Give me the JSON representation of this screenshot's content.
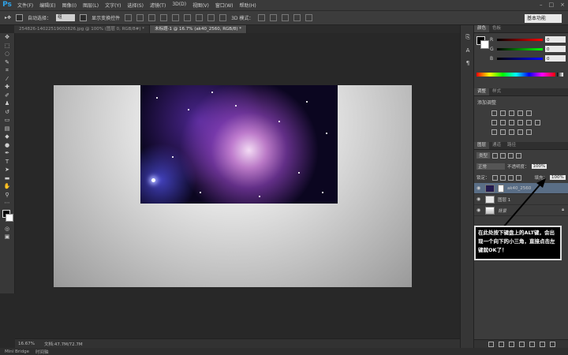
{
  "app": {
    "logo": "Ps"
  },
  "menu": [
    "文件(F)",
    "编辑(E)",
    "图像(I)",
    "图层(L)",
    "文字(Y)",
    "选择(S)",
    "滤镜(T)",
    "3D(D)",
    "视图(V)",
    "窗口(W)",
    "帮助(H)"
  ],
  "window_buttons": [
    "–",
    "□",
    "×"
  ],
  "options_bar": {
    "auto_select_label": "自动选择：",
    "auto_select_value": "组",
    "show_transform_label": "显示变换控件",
    "mode_3d_label": "3D 模式：",
    "workspace": "基本功能"
  },
  "tabs": [
    {
      "label": "254826-14022519002826.jpg @ 100% (图层 0, RGB/8#) *",
      "active": false
    },
    {
      "label": "未标题-1 @ 16.7% (ak40_2560, RGB/8) *",
      "active": true
    }
  ],
  "status": {
    "zoom": "16.67%",
    "doc": "文档:47.7M/72.7M"
  },
  "bottom": {
    "mini_bridge": "Mini Bridge",
    "timeline": "时间轴"
  },
  "color_panel": {
    "tabs": [
      "颜色",
      "色板"
    ],
    "rows": [
      {
        "label": "R",
        "value": "0"
      },
      {
        "label": "G",
        "value": "0"
      },
      {
        "label": "B",
        "value": "0"
      }
    ]
  },
  "adjust_panel": {
    "tabs": [
      "调整",
      "样式"
    ],
    "title": "添加调整"
  },
  "layers_panel": {
    "tabs": [
      "图层",
      "通道",
      "路径"
    ],
    "filter": "类型",
    "blend_mode": "正常",
    "opacity_label": "不透明度：",
    "opacity": "100%",
    "lock_label": "锁定：",
    "fill_label": "填充：",
    "fill": "100%",
    "layers": [
      {
        "name": "ak40_2560",
        "selected": true
      },
      {
        "name": "图层 1",
        "selected": false
      },
      {
        "name": "背景",
        "selected": false
      }
    ]
  },
  "annotation": "在此处按下键盘上的ALT键，会出现一个向下的小三角，直接点击左键就OK了！",
  "colors": {
    "accent": "#2fa3e8",
    "selected_layer": "#5a6e86"
  }
}
